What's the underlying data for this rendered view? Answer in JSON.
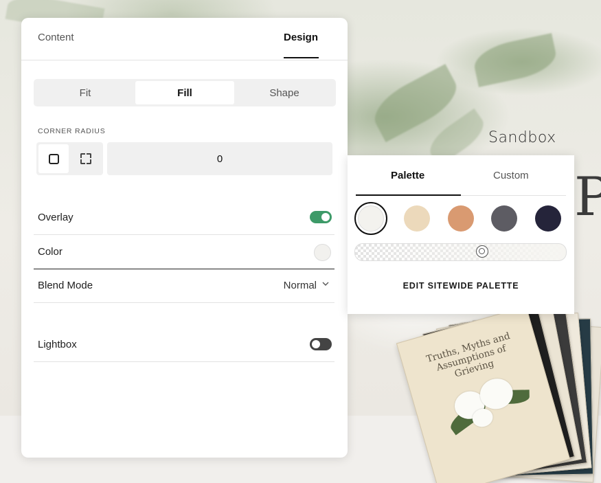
{
  "site": {
    "title": "Sandbox",
    "hero_letter": "P"
  },
  "book": {
    "title": "Truths, Myths and Assumptions of Grieving"
  },
  "panel": {
    "tabs": {
      "content": "Content",
      "design": "Design",
      "active": "design"
    },
    "fit_modes": [
      {
        "label": "Fit",
        "active": false
      },
      {
        "label": "Fill",
        "active": true
      },
      {
        "label": "Shape",
        "active": false
      }
    ],
    "corner_radius": {
      "label": "CORNER RADIUS",
      "value": "0",
      "mode": "uniform"
    },
    "overlay": {
      "label": "Overlay",
      "enabled": true
    },
    "color": {
      "label": "Color",
      "value_hex": "#f2f1ee"
    },
    "blend_mode": {
      "label": "Blend Mode",
      "value": "Normal"
    },
    "lightbox": {
      "label": "Lightbox",
      "enabled": false
    }
  },
  "color_popover": {
    "tabs": {
      "palette": "Palette",
      "custom": "Custom",
      "active": "palette"
    },
    "swatches": [
      {
        "hex": "#f3f2ee",
        "selected": true
      },
      {
        "hex": "#ecd9bb",
        "selected": false
      },
      {
        "hex": "#d99a71",
        "selected": false
      },
      {
        "hex": "#5d5c63",
        "selected": false
      },
      {
        "hex": "#25243a",
        "selected": false
      }
    ],
    "opacity_fraction": 0.61,
    "edit_label": "EDIT SITEWIDE PALETTE"
  },
  "colors": {
    "toggle_on": "#3d9a68",
    "toggle_off": "#444444",
    "accent": "#111111"
  }
}
